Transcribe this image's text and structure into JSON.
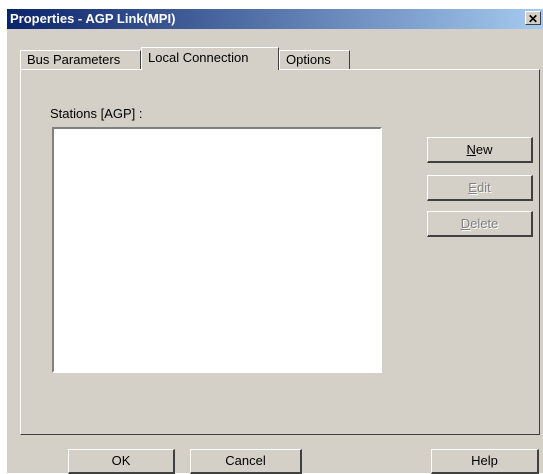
{
  "window": {
    "title": "Properties - AGP Link(MPI)",
    "close_glyph": "✕"
  },
  "tabs": [
    {
      "label": "Bus Parameters",
      "active": false
    },
    {
      "label": "Local Connection",
      "active": true
    },
    {
      "label": "Options",
      "active": false
    }
  ],
  "stations": {
    "label": "Stations [AGP] :",
    "items": []
  },
  "side_buttons": {
    "new": {
      "mnemonic": "N",
      "rest": "ew",
      "enabled": true
    },
    "edit": {
      "mnemonic": "E",
      "rest": "dit",
      "enabled": false
    },
    "delete": {
      "mnemonic": "D",
      "rest": "elete",
      "enabled": false
    }
  },
  "footer_buttons": {
    "ok": "OK",
    "cancel": "Cancel",
    "help": "Help"
  },
  "colors": {
    "face": "#d4d0c8",
    "titlebar_start": "#0a246a",
    "titlebar_end": "#a6caf0",
    "disabled_text": "#808080"
  }
}
